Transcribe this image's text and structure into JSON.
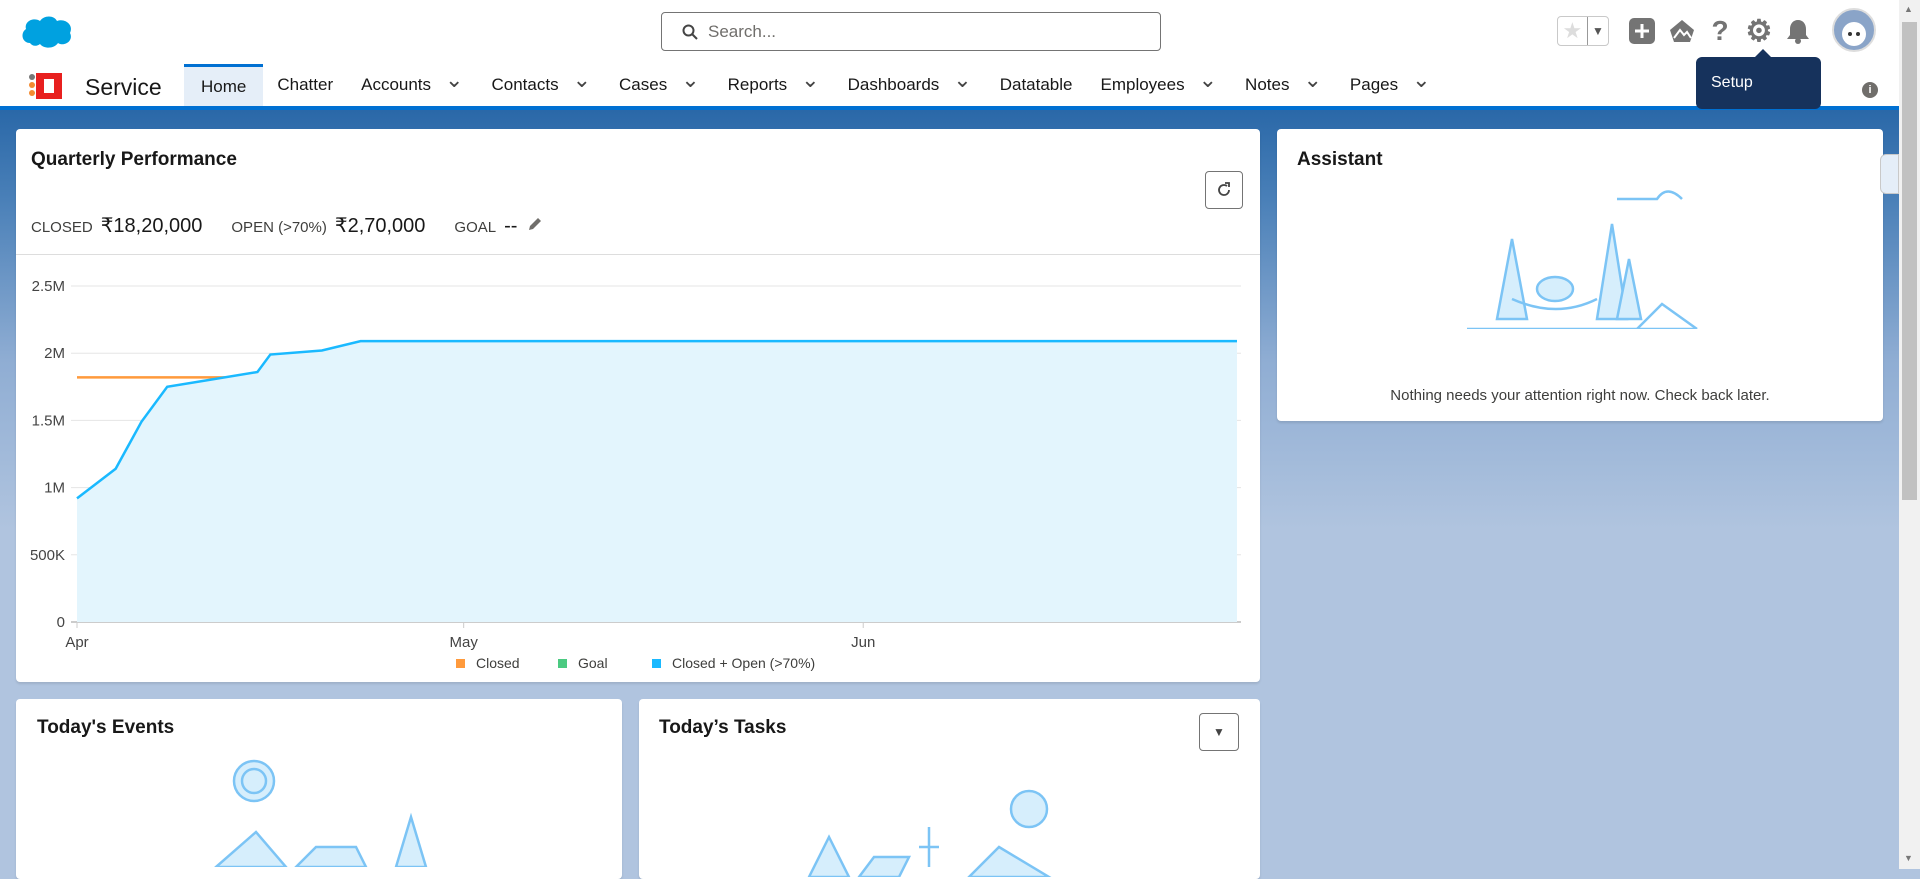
{
  "header": {
    "search_placeholder": "Search...",
    "tooltip": "Setup"
  },
  "nav": {
    "app_name": "Service",
    "items": [
      {
        "label": "Home",
        "active": true,
        "dropdown": false
      },
      {
        "label": "Chatter",
        "dropdown": false
      },
      {
        "label": "Accounts",
        "dropdown": true
      },
      {
        "label": "Contacts",
        "dropdown": true
      },
      {
        "label": "Cases",
        "dropdown": true
      },
      {
        "label": "Reports",
        "dropdown": true
      },
      {
        "label": "Dashboards",
        "dropdown": true
      },
      {
        "label": "Datatable",
        "dropdown": false
      },
      {
        "label": "Employees",
        "dropdown": true
      },
      {
        "label": "Notes",
        "dropdown": true
      },
      {
        "label": "Pages",
        "dropdown": true
      }
    ]
  },
  "quarterly": {
    "title": "Quarterly Performance",
    "closed_label": "CLOSED",
    "closed_value": "₹18,20,000",
    "open_label": "OPEN (>70%)",
    "open_value": "₹2,70,000",
    "goal_label": "GOAL",
    "goal_value": "--"
  },
  "chart_data": {
    "type": "line",
    "ylim": [
      0,
      2500000
    ],
    "yticks": [
      0,
      500000,
      1000000,
      1500000,
      2000000,
      2500000
    ],
    "ytick_labels": [
      "0",
      "500K",
      "1M",
      "1.5M",
      "2M",
      "2.5M"
    ],
    "xticks": [
      "2024-04-01",
      "2024-05-01",
      "2024-06-01"
    ],
    "xtick_labels": [
      "Apr",
      "May",
      "Jun"
    ],
    "xlim": [
      "2024-04-01",
      "2024-06-30"
    ],
    "grid": true,
    "legend": "bottom",
    "series": [
      {
        "name": "Closed",
        "color": "#ff9a3c",
        "points": [
          [
            "2024-04-01",
            1820000
          ],
          [
            "2024-06-30",
            1820000
          ]
        ]
      },
      {
        "name": "Goal",
        "color": "#4bca81",
        "points": []
      },
      {
        "name": "Closed + Open (>70%)",
        "color": "#1ab9ff",
        "area": true,
        "points": [
          [
            "2024-04-01",
            920000
          ],
          [
            "2024-04-04",
            1140000
          ],
          [
            "2024-04-06",
            1490000
          ],
          [
            "2024-04-08",
            1750000
          ],
          [
            "2024-04-15",
            1860000
          ],
          [
            "2024-04-16",
            1990000
          ],
          [
            "2024-04-20",
            2020000
          ],
          [
            "2024-04-23",
            2090000
          ],
          [
            "2024-06-30",
            2090000
          ]
        ]
      }
    ]
  },
  "assistant": {
    "title": "Assistant",
    "message": "Nothing needs your attention right now. Check back later."
  },
  "events": {
    "title": "Today's Events"
  },
  "tasks": {
    "title": "Today’s Tasks"
  }
}
